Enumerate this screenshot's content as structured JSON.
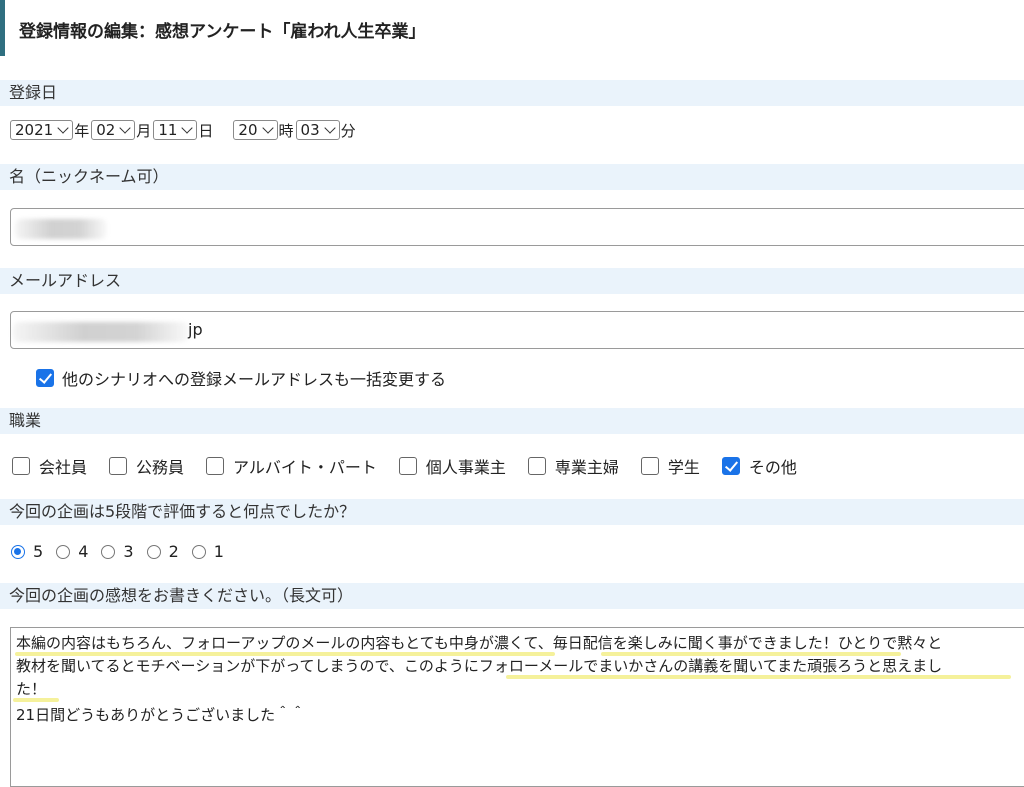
{
  "page": {
    "title": "登録情報の編集：感想アンケート「雇われ人生卒業」"
  },
  "registration_date": {
    "label": "登録日",
    "year": "2021",
    "year_unit": "年",
    "month": "02",
    "month_unit": "月",
    "day": "11",
    "day_unit": "日",
    "hour": "20",
    "hour_unit": "時",
    "minute": "03",
    "minute_unit": "分"
  },
  "name_field": {
    "label": "名（ニックネーム可）",
    "value": ""
  },
  "email_field": {
    "label": "メールアドレス",
    "visible_suffix": "jp",
    "bulk_change_label": "他のシナリオへの登録メールアドレスも一括変更する",
    "bulk_change_checked": true
  },
  "occupation": {
    "label": "職業",
    "options": [
      {
        "label": "会社員",
        "checked": false
      },
      {
        "label": "公務員",
        "checked": false
      },
      {
        "label": "アルバイト・パート",
        "checked": false
      },
      {
        "label": "個人事業主",
        "checked": false
      },
      {
        "label": "専業主婦",
        "checked": false
      },
      {
        "label": "学生",
        "checked": false
      },
      {
        "label": "その他",
        "checked": true
      }
    ]
  },
  "rating": {
    "label": "今回の企画は5段階で評価すると何点でしたか？",
    "options": [
      "5",
      "4",
      "3",
      "2",
      "1"
    ],
    "selected": "5"
  },
  "impressions": {
    "label": "今回の企画の感想をお書きください。（長文可）",
    "lines": [
      "本編の内容はもちろん、フォローアップのメールの内容もとても中身が濃くて、毎日配信を楽しみに聞く事ができました！ひとりで黙々と",
      "教材を聞いてるとモチベーションが下がってしまうので、このようにフォローメールでまいかさんの講義を聞いてまた頑張ろうと思えまし",
      "た！",
      "21日間どうもありがとうございました＾＾"
    ]
  },
  "colors": {
    "accent": "#1a73e8",
    "section_bg": "#eaf3fb",
    "title_border": "#2f6f80",
    "highlight": "#f3ee8a"
  }
}
